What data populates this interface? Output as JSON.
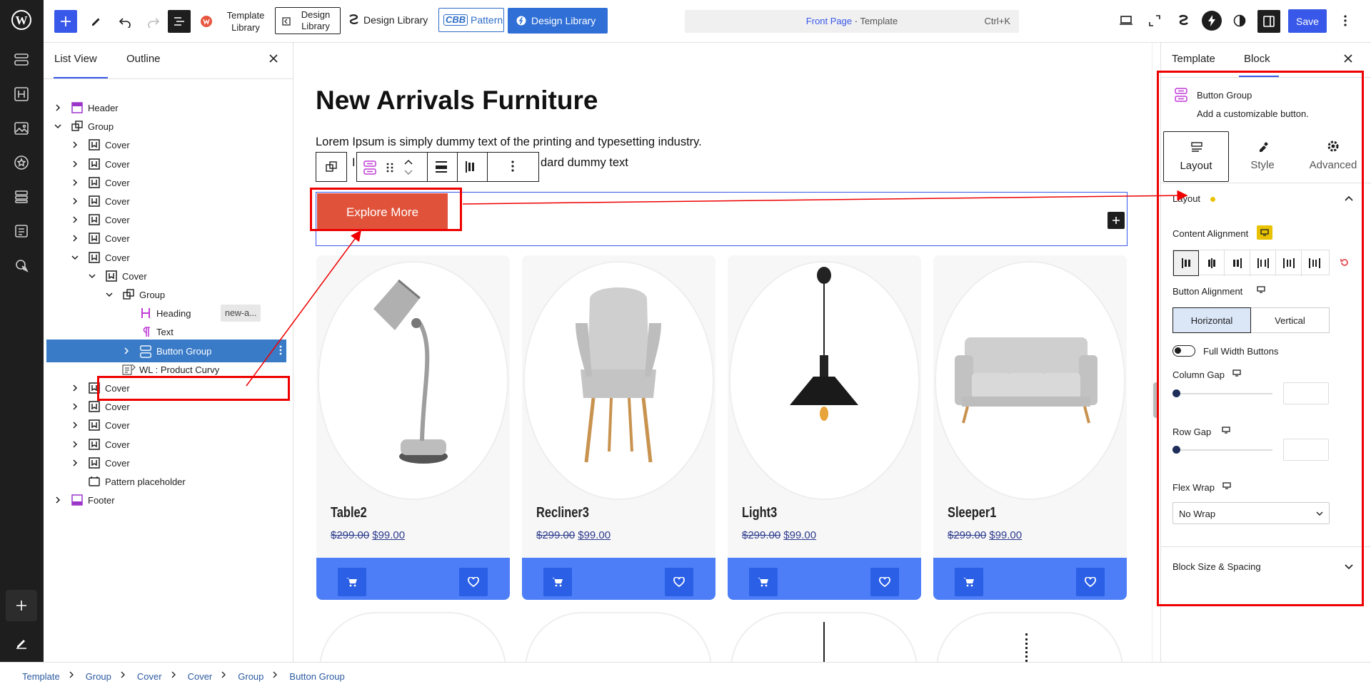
{
  "topbar": {
    "template_library": "Template\nLibrary",
    "design_library_1": "Design\nLibrary",
    "design_library_2": "Design Library",
    "cbb_badge": "CBB",
    "pattern": "Pattern",
    "design_library_3": "Design Library",
    "command_title": "Front Page",
    "command_sep": " · ",
    "command_suffix": "Template",
    "command_shortcut": "Ctrl+K",
    "save": "Save"
  },
  "listview": {
    "tabs": [
      "List View",
      "Outline"
    ],
    "rows": [
      {
        "label": "Header"
      },
      {
        "label": "Group"
      },
      {
        "label": "Cover"
      },
      {
        "label": "Cover"
      },
      {
        "label": "Cover"
      },
      {
        "label": "Cover"
      },
      {
        "label": "Cover"
      },
      {
        "label": "Cover"
      },
      {
        "label": "Cover"
      },
      {
        "label": "Cover"
      },
      {
        "label": "Group"
      },
      {
        "label": "Heading",
        "badge": "new-a..."
      },
      {
        "label": "Text"
      },
      {
        "label": "Button Group"
      },
      {
        "label": "WL : Product Curvy"
      },
      {
        "label": "Cover"
      },
      {
        "label": "Cover"
      },
      {
        "label": "Cover"
      },
      {
        "label": "Cover"
      },
      {
        "label": "Cover"
      },
      {
        "label": "Pattern placeholder"
      },
      {
        "label": "Footer"
      }
    ]
  },
  "canvas": {
    "heading": "New Arrivals Furniture",
    "paragraph_line1": "Lorem Ipsum is simply dummy text of the printing and typesetting industry.",
    "paragraph_line2_start": "I",
    "paragraph_line2_end": "dard dummy text",
    "button": "Explore More",
    "products": [
      {
        "name": "Table2",
        "old_price": "$299.00",
        "price": "$99.00"
      },
      {
        "name": "Recliner3",
        "old_price": "$299.00",
        "price": "$99.00"
      },
      {
        "name": "Light3",
        "old_price": "$299.00",
        "price": "$99.00"
      },
      {
        "name": "Sleeper1",
        "old_price": "$299.00",
        "price": "$99.00"
      }
    ]
  },
  "rightpanel": {
    "tabs": [
      "Template",
      "Block"
    ],
    "block_title": "Button Group",
    "block_desc": "Add a customizable button.",
    "subtabs": [
      "Layout",
      "Style",
      "Advanced"
    ],
    "section_layout": "Layout",
    "content_alignment": "Content Alignment",
    "button_alignment": "Button Alignment",
    "orientation": [
      "Horizontal",
      "Vertical"
    ],
    "full_width": "Full Width Buttons",
    "full_width_on": false,
    "column_gap": "Column Gap",
    "row_gap": "Row Gap",
    "column_gap_value": 0,
    "row_gap_value": 0,
    "flex_wrap": "Flex Wrap",
    "flex_wrap_value": "No Wrap",
    "block_size": "Block Size & Spacing"
  },
  "breadcrumb": [
    "Template",
    "Group",
    "Cover",
    "Cover",
    "Group",
    "Button Group"
  ],
  "colors": {
    "accent": "#3858e9",
    "selected_row": "#3a7bc8",
    "button_bg": "#e0533a",
    "product_bar": "#4d7ef7",
    "annotation": "#e00000"
  }
}
